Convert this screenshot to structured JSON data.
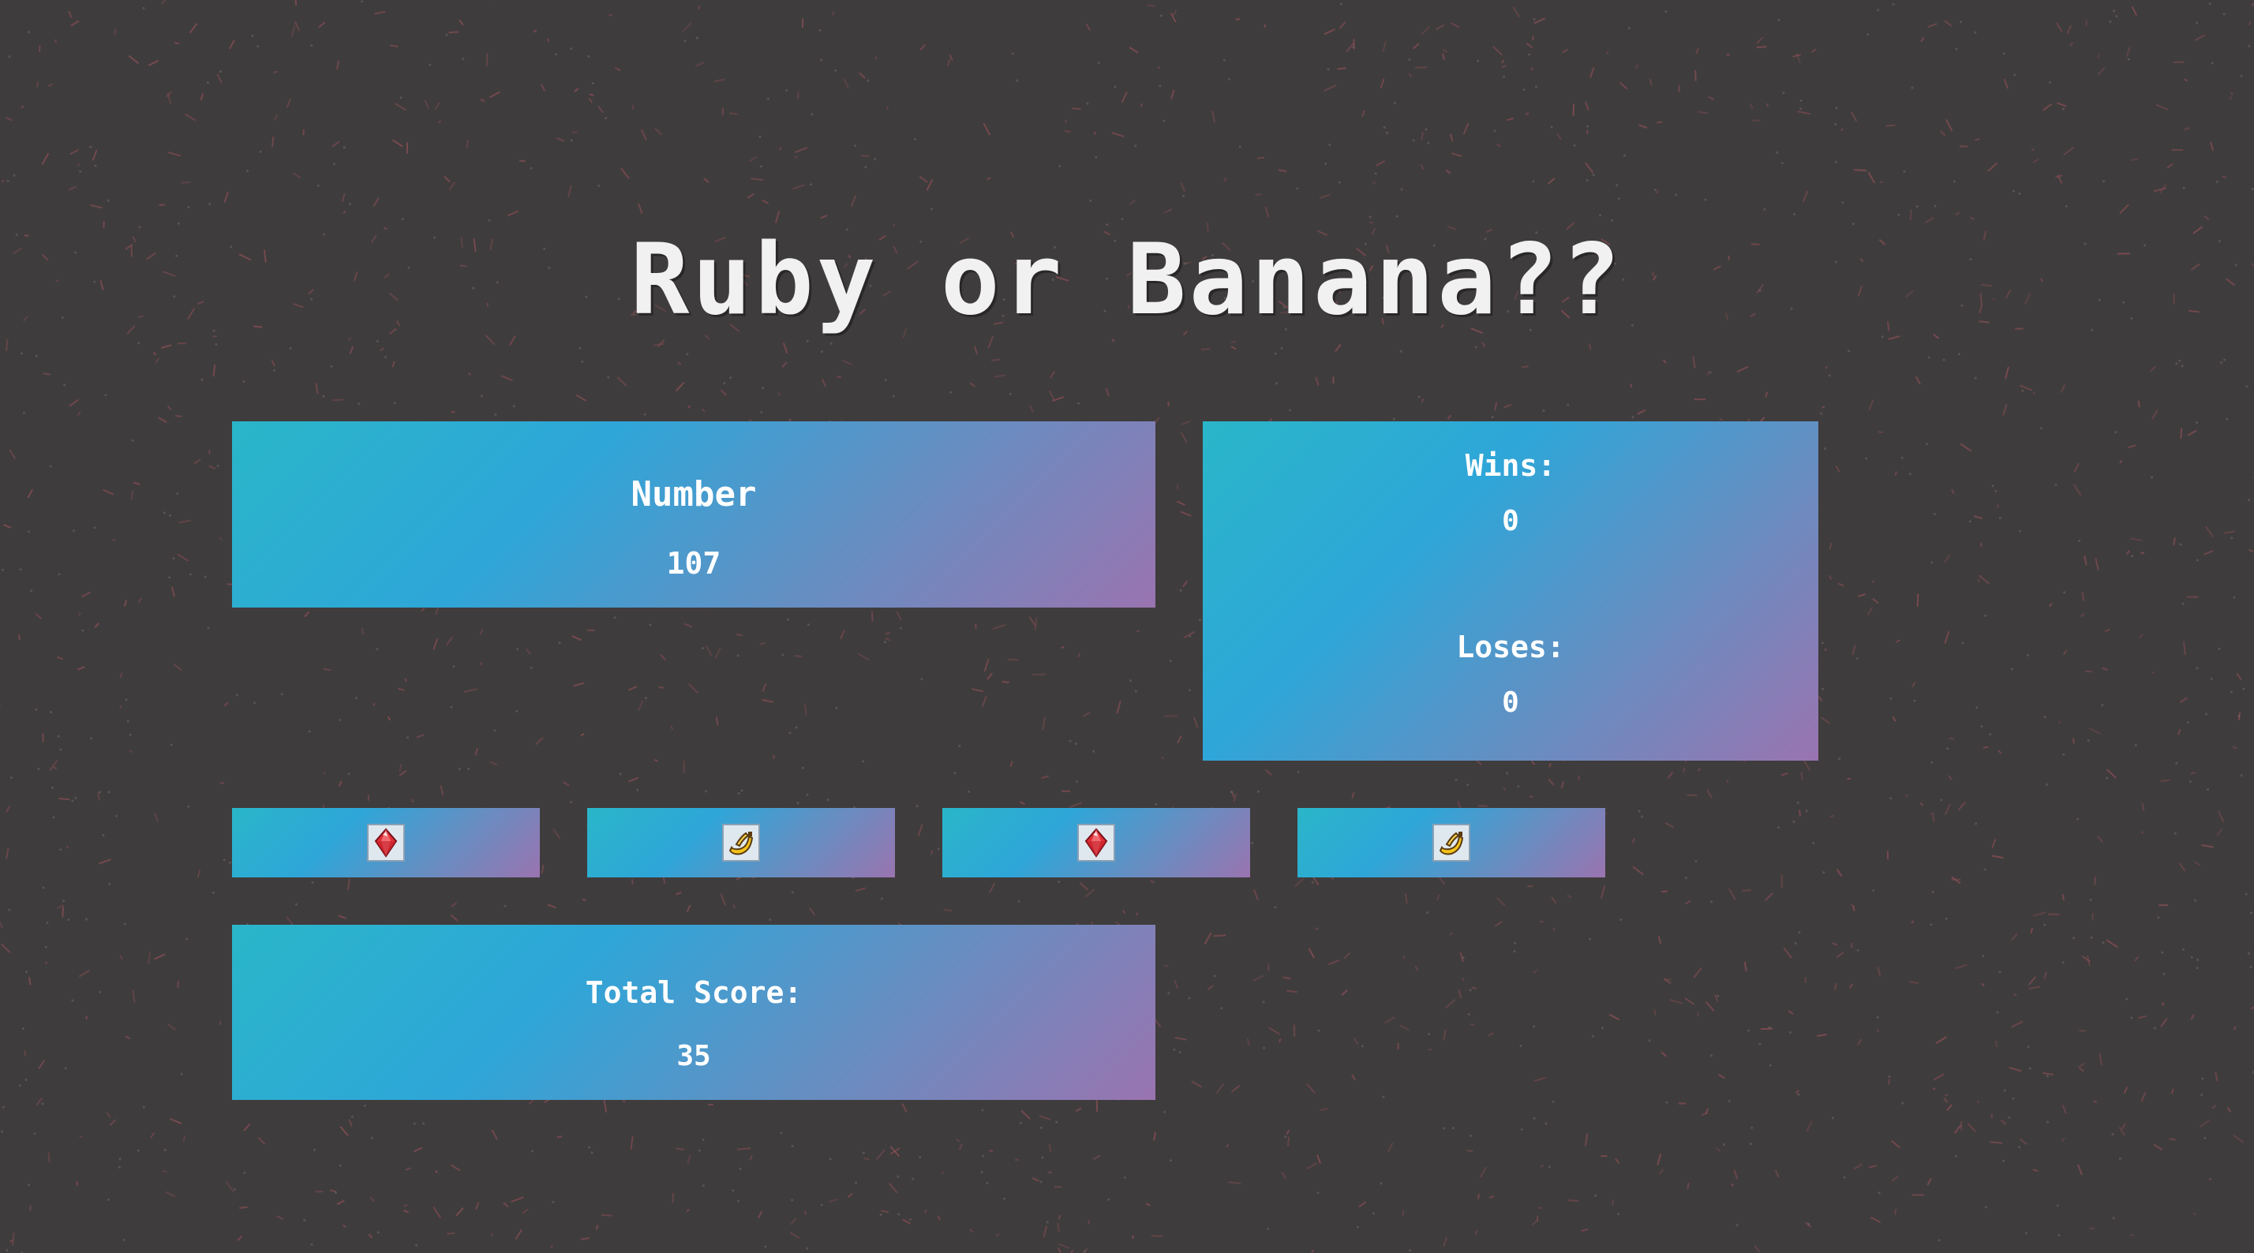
{
  "title": "Ruby or Banana??",
  "number": {
    "label": "Number",
    "value": "107"
  },
  "stats": {
    "wins_label": "Wins:",
    "wins_value": "0",
    "loses_label": "Loses:",
    "loses_value": "0"
  },
  "choices": [
    {
      "icon": "ruby-icon"
    },
    {
      "icon": "banana-icon"
    },
    {
      "icon": "ruby-icon"
    },
    {
      "icon": "banana-icon"
    }
  ],
  "score": {
    "label": "Total Score:",
    "value": "35"
  },
  "colors": {
    "background": "#3f3c3d",
    "speckle": "#8a4f55",
    "panel_gradient_start": "#2ab6c9",
    "panel_gradient_mid": "#2ea6d8",
    "panel_gradient_end": "#9a74b0",
    "title": "#f1f1f1",
    "ruby": "#e0303a",
    "banana": "#f2c21a"
  }
}
